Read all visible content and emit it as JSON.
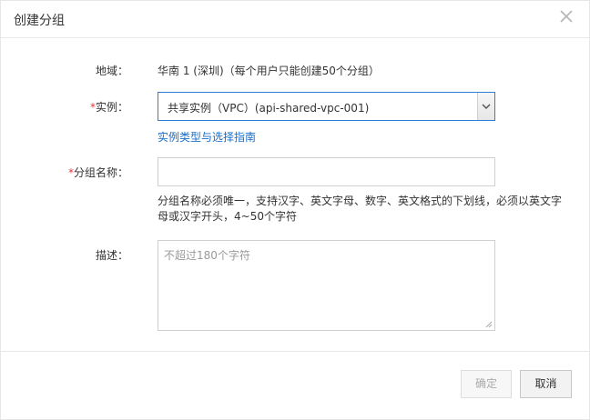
{
  "dialog": {
    "title": "创建分组",
    "close_icon": "close-icon"
  },
  "form": {
    "region": {
      "label": "地域：",
      "value": "华南 1 (深圳)（每个用户只能创建50个分组）"
    },
    "instance": {
      "required_mark": "*",
      "label": "实例：",
      "selected": "共享实例（VPC）(api-shared-vpc-001)",
      "guide_link": "实例类型与选择指南"
    },
    "group_name": {
      "required_mark": "*",
      "label": "分组名称：",
      "value": "",
      "hint_line1": "分组名称必须唯一，支持汉字、英文字母、数字、英文格式的下划线，必须以英文字",
      "hint_line2": "母或汉字开头，4~50个字符"
    },
    "description": {
      "label": "描述：",
      "placeholder": "不超过180个字符",
      "value": ""
    }
  },
  "footer": {
    "confirm_label": "确定",
    "cancel_label": "取消"
  },
  "colors": {
    "required": "#e4393c",
    "link": "#1a6fc9",
    "focus_border": "#2b7fd6"
  }
}
